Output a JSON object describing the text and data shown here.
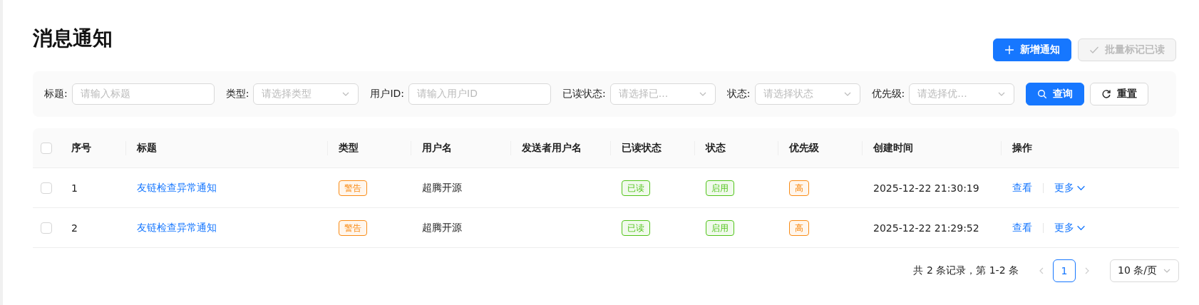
{
  "page": {
    "title": "消息通知"
  },
  "actions": [
    {
      "label": "新增通知",
      "kind": "primary",
      "disabled": false
    },
    {
      "label": "批量标记已读",
      "kind": "default",
      "disabled": true
    }
  ],
  "filters": [
    {
      "label": "标题:",
      "kind": "input",
      "placeholder": "请输入标题"
    },
    {
      "label": "类型:",
      "kind": "select",
      "placeholder": "请选择类型"
    },
    {
      "label": "用户ID:",
      "kind": "input",
      "placeholder": "请输入用户ID"
    },
    {
      "label": "已读状态:",
      "kind": "select",
      "placeholder": "请选择已..."
    },
    {
      "label": "状态:",
      "kind": "select",
      "placeholder": "请选择状态"
    },
    {
      "label": "优先级:",
      "kind": "select",
      "placeholder": "请选择优..."
    }
  ],
  "filter_buttons": [
    {
      "label": "查询",
      "kind": "primary"
    },
    {
      "label": "重置",
      "kind": "default"
    }
  ],
  "table": {
    "select_all_checked": false,
    "columns": [
      "序号",
      "标题",
      "类型",
      "用户名",
      "发送者用户名",
      "已读状态",
      "状态",
      "优先级",
      "创建时间",
      "操作"
    ],
    "rows": [
      {
        "checked": false,
        "index": "1",
        "title": "友链检查异常通知",
        "type": {
          "text": "警告",
          "color": "#fa8c16"
        },
        "user": "超腾开源",
        "read": {
          "text": "已读",
          "color": "#52c41a"
        },
        "status": {
          "text": "启用",
          "color": "#52c41a"
        },
        "priority": {
          "text": "高",
          "color": "#fa8c16"
        },
        "created": "2025-12-22 21:30:19",
        "ops": [
          "查看",
          "更多"
        ]
      },
      {
        "checked": false,
        "index": "2",
        "title": "友链检查异常通知",
        "type": {
          "text": "警告",
          "color": "#fa8c16"
        },
        "user": "超腾开源",
        "read": {
          "text": "已读",
          "color": "#52c41a"
        },
        "status": {
          "text": "启用",
          "color": "#52c41a"
        },
        "priority": {
          "text": "高",
          "color": "#fa8c16"
        },
        "created": "2025-12-22 21:29:52",
        "ops": [
          "查看",
          "更多"
        ]
      }
    ]
  },
  "pagination": {
    "summary": "共 2 条记录，第 1-2 条",
    "pages": [
      {
        "label": "1",
        "selected": true
      }
    ],
    "page_size": "10 条/页"
  }
}
